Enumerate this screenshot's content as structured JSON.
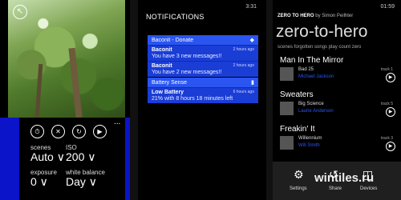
{
  "camera": {
    "top_icon": "arrow-icon",
    "mode_icons": [
      "timer-icon",
      "flash-off-icon",
      "camera-switch-icon",
      "video-icon"
    ],
    "more": "...",
    "scenes_label": "scenes",
    "scenes_value": "Auto ∨",
    "iso_label": "ISO",
    "iso_value": "200 ∨",
    "exposure_label": "exposure",
    "exposure_value": "0 ∨",
    "wb_label": "white balance",
    "wb_value": "Day ∨"
  },
  "notifications": {
    "time": "3:31",
    "title": "NOTIFICATIONS",
    "groups": [
      {
        "app": "Baconit - Donate",
        "items": [
          {
            "title": "Baconit",
            "age": "2 hours ago",
            "text": "You have 3 new messages!!"
          },
          {
            "title": "Baconit",
            "age": "2 hours ago",
            "text": "You have 2 new messages!!"
          }
        ]
      },
      {
        "app": "Battery Sense",
        "items": [
          {
            "title": "Low Battery",
            "age": "6 hours ago",
            "text": "21% with 8 hours 18 minutes left"
          }
        ]
      }
    ]
  },
  "music": {
    "clock": "01:59",
    "crumb_app": "ZERO TO HERO",
    "crumb_rest": " by Simon Peilhter",
    "big_title": "zero-to-hero",
    "subtitle": "scenes  forgotten songs  play count zero",
    "tracks": [
      {
        "title": "Man In The Mirror",
        "album": "Bad 25",
        "artist": "Michael Jackson",
        "num": "track 1"
      },
      {
        "title": "Sweaters",
        "album": "Big Science",
        "artist": "Laurie Anderson",
        "num": "track 5"
      },
      {
        "title": "Freakin' It",
        "album": "Willennium",
        "artist": "Will Smith",
        "num": "track 3"
      }
    ],
    "bar": {
      "settings": "Settings",
      "share": "Share",
      "devices": "Devices"
    },
    "watermark": "wintiles.ru"
  }
}
